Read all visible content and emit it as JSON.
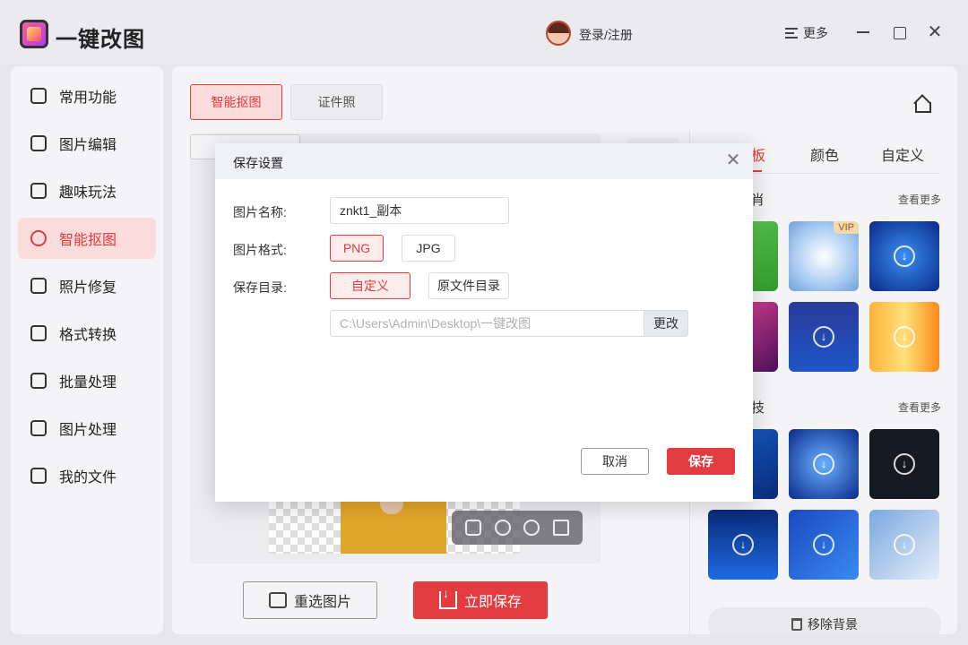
{
  "app": {
    "title": "一键改图",
    "login": "登录/注册",
    "more": "更多"
  },
  "sidebar": {
    "items": [
      {
        "label": "常用功能",
        "icon": "grid-icon"
      },
      {
        "label": "图片编辑",
        "icon": "edit-icon"
      },
      {
        "label": "趣味玩法",
        "icon": "magic-wand-icon"
      },
      {
        "label": "智能抠图",
        "icon": "cutout-icon",
        "active": true
      },
      {
        "label": "照片修复",
        "icon": "repair-icon"
      },
      {
        "label": "格式转换",
        "icon": "convert-icon"
      },
      {
        "label": "批量处理",
        "icon": "layers-icon"
      },
      {
        "label": "图片处理",
        "icon": "image-icon"
      },
      {
        "label": "我的文件",
        "icon": "file-icon"
      }
    ]
  },
  "main": {
    "tabs": [
      "智能抠图",
      "证件照"
    ],
    "reselect_label": "重选图片",
    "save_now_label": "立即保存"
  },
  "right_panel": {
    "tabs": [
      "颜色",
      "自定义"
    ],
    "tab_partial": "板",
    "section1_title": "肖",
    "section2_title": "技",
    "more_label": "查看更多",
    "vip_label": "VIP",
    "remove_bg_label": "移除背景"
  },
  "modal": {
    "title": "保存设置",
    "name_label": "图片名称:",
    "name_value": "znkt1_副本",
    "format_label": "图片格式:",
    "formats": [
      "PNG",
      "JPG"
    ],
    "selected_format": "PNG",
    "dir_label": "保存目录:",
    "dir_options": [
      "自定义",
      "原文件目录"
    ],
    "selected_dir": "自定义",
    "path_value": "C:\\Users\\Admin\\Desktop\\一键改图",
    "change_label": "更改",
    "cancel_label": "取消",
    "save_label": "保存"
  },
  "colors": {
    "accent": "#e23b40",
    "accent_light": "#fbdcdc"
  }
}
